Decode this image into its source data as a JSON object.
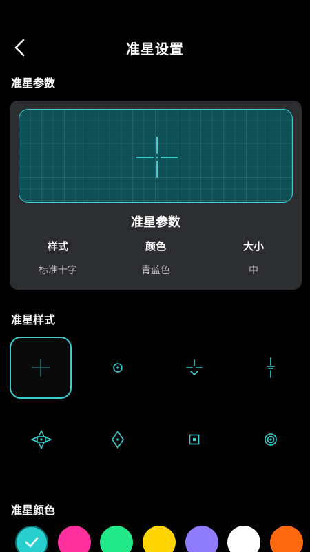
{
  "header": {
    "title": "准星设置",
    "back_icon": "chevron-left-icon"
  },
  "params_section": {
    "title": "准星参数"
  },
  "param_card": {
    "heading": "准星参数",
    "columns": [
      {
        "label": "样式",
        "value": "标准十字"
      },
      {
        "label": "颜色",
        "value": "青蓝色"
      },
      {
        "label": "大小",
        "value": "中"
      }
    ]
  },
  "style_section": {
    "title": "准星样式",
    "styles": [
      {
        "icon": "plus-crosshair-icon",
        "selected": true
      },
      {
        "icon": "dot-circle-crosshair-icon",
        "selected": false
      },
      {
        "icon": "t-shaped-crosshair-icon",
        "selected": false
      },
      {
        "icon": "vertical-line-crosshair-icon",
        "selected": false
      },
      {
        "icon": "star-diamond-crosshair-icon",
        "selected": false
      },
      {
        "icon": "diamond-dot-crosshair-icon",
        "selected": false
      },
      {
        "icon": "square-dot-crosshair-icon",
        "selected": false
      },
      {
        "icon": "double-circle-crosshair-icon",
        "selected": false
      }
    ]
  },
  "color_section": {
    "title": "准星颜色",
    "colors": [
      "#2ad0cf",
      "#ff2f9e",
      "#22e88a",
      "#ffd400",
      "#8f7bff",
      "#ffffff",
      "#ff6a10"
    ],
    "selected_index": 0
  },
  "accent_color": "#3ad0d0"
}
